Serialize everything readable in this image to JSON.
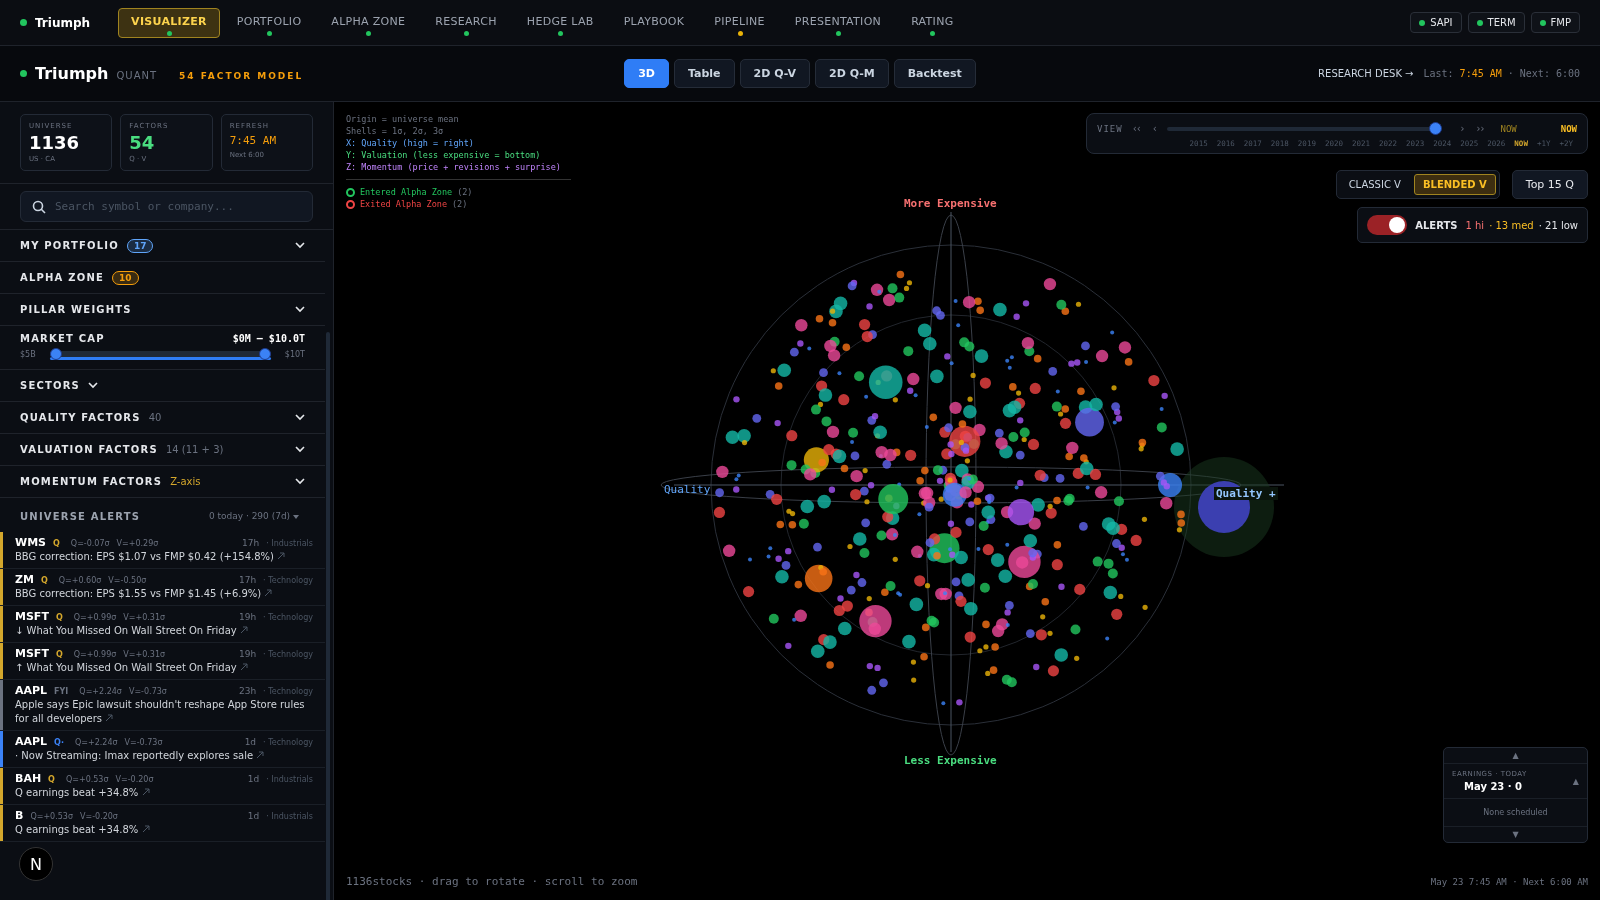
{
  "app": {
    "name": "Triumph"
  },
  "nav": [
    {
      "label": "VISUALIZER",
      "selected": true,
      "color": "#22c55e"
    },
    {
      "label": "PORTFOLIO",
      "selected": false,
      "color": "#22c55e"
    },
    {
      "label": "ALPHA ZONE",
      "selected": false,
      "color": "#22c55e"
    },
    {
      "label": "RESEARCH",
      "selected": false,
      "color": "#22c55e"
    },
    {
      "label": "HEDGE LAB",
      "selected": false,
      "color": "#22c55e"
    },
    {
      "label": "PLAYBOOK",
      "selected": false
    },
    {
      "label": "PIPELINE",
      "selected": false,
      "color": "#eab308"
    },
    {
      "label": "PRESENTATION",
      "selected": false,
      "color": "#22c55e"
    },
    {
      "label": "RATING",
      "selected": false,
      "color": "#22c55e"
    }
  ],
  "services": [
    {
      "label": "SAPI",
      "color": "#22c55e"
    },
    {
      "label": "TERM",
      "color": "#22c55e"
    },
    {
      "label": "FMP",
      "color": "#22c55e"
    }
  ],
  "subheader": {
    "brand": "Triumph",
    "suffix": "QUANT",
    "model": "54 FACTOR MODEL",
    "research_desk": "RESEARCH DESK →",
    "last_label": "Last:",
    "last_time": "7:45 AM",
    "next": "· Next: 6:00"
  },
  "view_tabs": [
    {
      "label": "3D",
      "selected": true
    },
    {
      "label": "Table",
      "selected": false
    },
    {
      "label": "2D Q-V",
      "selected": false
    },
    {
      "label": "2D Q-M",
      "selected": false
    },
    {
      "label": "Backtest",
      "selected": false
    }
  ],
  "stats": [
    {
      "label": "UNIVERSE",
      "value": "1136",
      "sub": "US · CA",
      "kind": "plain"
    },
    {
      "label": "FACTORS",
      "value": "54",
      "sub": "Q · V",
      "kind": "green"
    },
    {
      "label": "REFRESH",
      "value": "7:45 AM",
      "sub": "Next 6:00",
      "kind": "time"
    }
  ],
  "search": {
    "placeholder": "Search symbol or company..."
  },
  "sections": [
    {
      "kind": "row",
      "label": "MY PORTFOLIO",
      "badge": "17",
      "color": "#60a5fa",
      "collapsible": true
    },
    {
      "kind": "row",
      "label": "ALPHA ZONE",
      "badge": "10",
      "color": "#f59e0b",
      "collapsible": false
    },
    {
      "kind": "row",
      "label": "PILLAR WEIGHTS",
      "collapsible": true
    },
    {
      "kind": "slider",
      "label": "MARKET CAP",
      "range": "$0M – $10.0T",
      "min_label": "$5B",
      "max_label": "$10T",
      "level": 1
    },
    {
      "kind": "compact",
      "label": "SECTORS",
      "collapsible": true
    },
    {
      "kind": "row",
      "label": "QUALITY FACTORS",
      "note": "40",
      "color": "#6b7280",
      "collapsible": true
    },
    {
      "kind": "row",
      "label": "VALUATION FACTORS",
      "note": "14 (11 + 3)",
      "color": "#6b7280",
      "collapsible": true
    },
    {
      "kind": "row",
      "label": "MOMENTUM FACTORS",
      "note": "Z-axis",
      "color": "#d4a72c",
      "collapsible": true
    }
  ],
  "alerts_header": {
    "title": "UNIVERSE ALERTS",
    "summary": "0 today · 290 (7d)"
  },
  "alerts": [
    {
      "ticker": "WMS",
      "tag": "Q",
      "color": "#d4a72c",
      "q": "Q=-0.07σ",
      "v": "V=+0.29σ",
      "age": "17h",
      "sector": "· Industrials",
      "text": "BBG correction: EPS $1.07 vs FMP $0.42 (+154.8%)"
    },
    {
      "ticker": "ZM",
      "tag": "Q",
      "color": "#d4a72c",
      "q": "Q=+0.60σ",
      "v": "V=-0.50σ",
      "age": "17h",
      "sector": "· Technology",
      "text": "BBG correction: EPS $1.55 vs FMP $1.45 (+6.9%)"
    },
    {
      "ticker": "MSFT",
      "tag": "Q",
      "color": "#d4a72c",
      "q": "Q=+0.99σ",
      "v": "V=+0.31σ",
      "age": "19h",
      "sector": "· Technology",
      "text": "↓ What You Missed On Wall Street On Friday"
    },
    {
      "ticker": "MSFT",
      "tag": "Q",
      "color": "#d4a72c",
      "q": "Q=+0.99σ",
      "v": "V=+0.31σ",
      "age": "19h",
      "sector": "· Technology",
      "text": "↑ What You Missed On Wall Street On Friday"
    },
    {
      "ticker": "AAPL",
      "tag": "FYI",
      "color": "#6b7280",
      "q": "Q=+2.24σ",
      "v": "V=-0.73σ",
      "age": "23h",
      "sector": "· Technology",
      "text": "Apple says Epic lawsuit shouldn't reshape App Store rules for all developers"
    },
    {
      "ticker": "AAPL",
      "tag": "Q·",
      "color": "#3b82f6",
      "q": "Q=+2.24σ",
      "v": "V=-0.73σ",
      "age": "1d",
      "sector": "· Technology",
      "text": "· Now Streaming: Imax reportedly explores sale"
    },
    {
      "ticker": "BAH",
      "tag": "Q",
      "color": "#d4a72c",
      "q": "Q=+0.53σ",
      "v": "V=-0.20σ",
      "age": "1d",
      "sector": "· Industrials",
      "text": "Q earnings beat +34.8%"
    },
    {
      "ticker": "B",
      "color": "#d4a72c",
      "q": "Q=+0.53σ",
      "v": "V=-0.20σ",
      "age": "1d",
      "sector": "· Industrials",
      "text": "Q earnings beat +34.8%"
    }
  ],
  "dev_badge": "N",
  "legend": {
    "lines": [
      {
        "text": "Origin = universe mean",
        "kind": "muted"
      },
      {
        "text": "Shells = 1σ, 2σ, 3σ",
        "kind": "muted"
      },
      {
        "text": "X: Quality (high = right)",
        "kind": "x"
      },
      {
        "text": "Y: Valuation (less expensive = bottom)",
        "kind": "y"
      },
      {
        "text": "Z: Momentum (price + revisions + surprise)",
        "kind": "z"
      }
    ],
    "zones": [
      {
        "label": "Entered Alpha Zone",
        "count": "(2)",
        "color": "#22c55e"
      },
      {
        "label": "Exited Alpha Zone",
        "count": "(2)",
        "color": "#ef4444"
      }
    ]
  },
  "axes": {
    "top": "More Expensive",
    "bottom": "Less Expensive",
    "left": "Quality",
    "right": "Quality +"
  },
  "timeline": {
    "label": "VIEW",
    "first": "‹‹",
    "prev": "‹",
    "next": "›",
    "last": "››",
    "now": "NOW",
    "current": "NOW",
    "level": 0.95,
    "years": [
      {
        "label": "2015",
        "selected": false
      },
      {
        "label": "2016",
        "selected": false
      },
      {
        "label": "2017",
        "selected": false
      },
      {
        "label": "2018",
        "selected": false
      },
      {
        "label": "2019",
        "selected": false
      },
      {
        "label": "2020",
        "selected": false
      },
      {
        "label": "2021",
        "selected": false
      },
      {
        "label": "2022",
        "selected": false
      },
      {
        "label": "2023",
        "selected": false
      },
      {
        "label": "2024",
        "selected": false
      },
      {
        "label": "2025",
        "selected": false
      },
      {
        "label": "2026",
        "selected": false
      },
      {
        "label": "NOW",
        "selected": true
      },
      {
        "label": "+1Y",
        "selected": false
      },
      {
        "label": "+2Y",
        "selected": false
      }
    ]
  },
  "valuation_modes": [
    {
      "label": "CLASSIC V",
      "selected": false
    },
    {
      "label": "BLENDED V",
      "selected": true
    }
  ],
  "top_button": "Top 15 Q",
  "alerts_toggle": {
    "on": true,
    "label": "ALERTS",
    "hi": "1 hi",
    "med": "· 13 med",
    "low": "· 21 low"
  },
  "earnings": {
    "title": "EARNINGS · TODAY",
    "date": "May 23 · 0",
    "empty": "None scheduled",
    "up": "▲",
    "down": "▼"
  },
  "footer": {
    "left": "1136stocks · drag to rotate · scroll to zoom",
    "right": "May 23 7:45 AM · Next 6:00 AM"
  }
}
